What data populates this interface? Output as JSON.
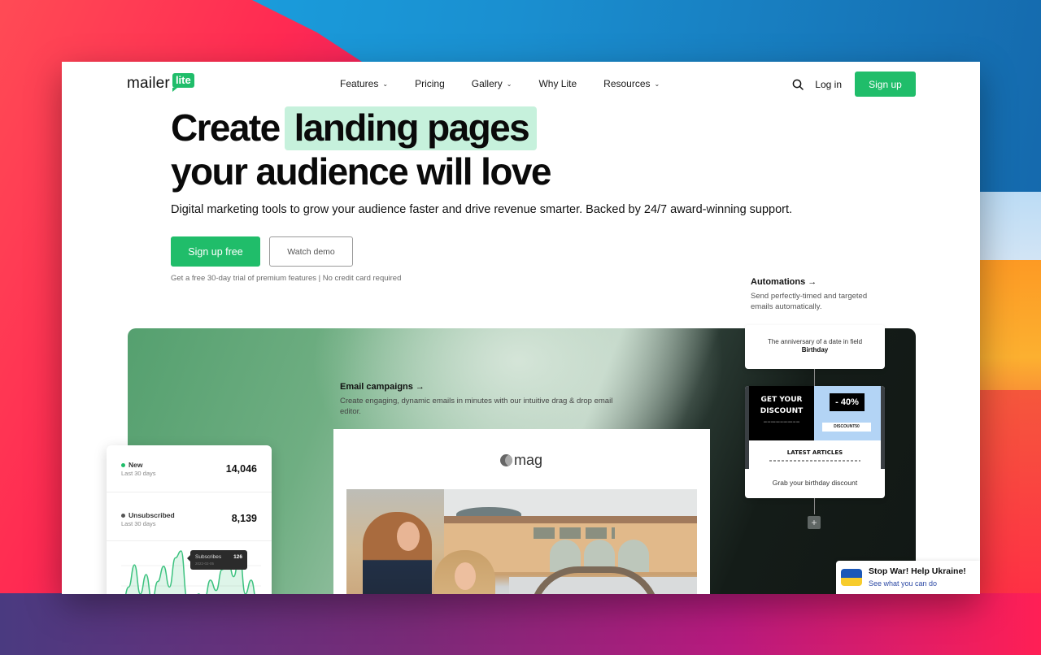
{
  "colors": {
    "brand_green": "#20bd6a",
    "highlight_green": "#c6f1dc",
    "ukraine_blue": "#1b58b8",
    "ukraine_yellow": "#f7cc2c"
  },
  "nav": {
    "logo_word": "mailer",
    "logo_badge": "lite",
    "links": [
      {
        "label": "Features",
        "has_dropdown": true
      },
      {
        "label": "Pricing",
        "has_dropdown": false
      },
      {
        "label": "Gallery",
        "has_dropdown": true
      },
      {
        "label": "Why Lite",
        "has_dropdown": false
      },
      {
        "label": "Resources",
        "has_dropdown": true
      }
    ],
    "search_icon": "search-icon",
    "login_label": "Log in",
    "signup_label": "Sign up"
  },
  "hero": {
    "title_part1": "Create",
    "title_highlight": "landing pages",
    "title_line2": "your audience will love",
    "subtitle": "Digital marketing tools to grow your audience faster and drive revenue smarter. Backed by 24/7 award-winning support.",
    "cta_primary": "Sign up free",
    "cta_secondary": "Watch demo",
    "note": "Get a free 30-day trial of premium features | No credit card required"
  },
  "automations": {
    "title": "Automations →",
    "description": "Send perfectly-timed and targeted emails automatically.",
    "trigger_text": "The anniversary of a date in field",
    "trigger_field": "Birthday",
    "email_node": {
      "headline_line1": "GET YOUR",
      "headline_line2": "DISCOUNT",
      "discount": "- 40%",
      "code": "DISCOUNT50",
      "articles_heading": "LATEST ARTICLES",
      "caption": "Grab your birthday discount"
    },
    "add_step_label": "+"
  },
  "email_campaigns": {
    "title": "Email campaigns →",
    "description": "Create engaging, dynamic emails in minutes with our intuitive drag & drop email editor.",
    "preview_brand": "mag"
  },
  "stats": {
    "rows": [
      {
        "label": "New",
        "sub": "Last 30 days",
        "value": "14,046",
        "dot_color": "#20bd6a"
      },
      {
        "label": "Unsubscribed",
        "sub": "Last 30 days",
        "value": "8,139",
        "dot_color": "#555555"
      }
    ],
    "tooltip": {
      "label": "Subscribes",
      "date": "2022-02-05",
      "value": "126"
    },
    "sparkline": [
      8,
      30,
      62,
      20,
      48,
      10,
      38,
      60,
      30,
      72,
      82,
      15,
      5,
      20,
      12,
      40,
      25,
      55,
      70,
      45,
      78,
      20,
      40,
      8
    ]
  },
  "ukraine_banner": {
    "title": "Stop War! Help Ukraine!",
    "link": "See what you can do"
  }
}
